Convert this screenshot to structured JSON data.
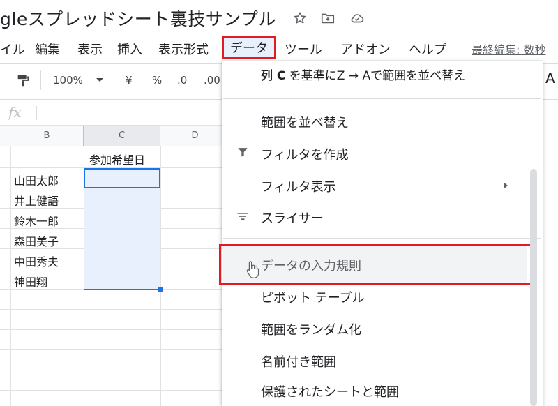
{
  "header": {
    "title": "gleスプレッドシート裏技サンプル",
    "icons": [
      "star-icon",
      "move-to-folder-icon",
      "cloud-saved-icon"
    ]
  },
  "menubar": {
    "items": [
      "イル",
      "編集",
      "表示",
      "挿入",
      "表示形式",
      "データ",
      "ツール",
      "アドオン",
      "ヘルプ"
    ],
    "last_edit": "最終編集: 数秒"
  },
  "toolbar": {
    "zoom": "100%",
    "currency": "¥",
    "percent": "%",
    "decrease_decimal": ".0",
    "increase_decimal": ".00",
    "text_color_glyph": "A"
  },
  "formula_bar": {
    "fx_label": "fx",
    "value": ""
  },
  "grid": {
    "columns": [
      "B",
      "C",
      "D"
    ],
    "header_cell": "参加希望日",
    "names": [
      "山田太郎",
      "井上健語",
      "鈴木一郎",
      "森田美子",
      "中田秀夫",
      "神田翔"
    ]
  },
  "data_menu": {
    "items": [
      {
        "label": "列 C を基準にZ → Aで範囲を並べ替え",
        "bold_prefix": "列 C",
        "icon": ""
      },
      {
        "label": "範囲を並べ替え",
        "icon": ""
      },
      {
        "label": "フィルタを作成",
        "icon": "filter-icon"
      },
      {
        "label": "フィルタ表示",
        "icon": "",
        "submenu": true
      },
      {
        "label": "スライサー",
        "icon": "slicer-icon"
      },
      {
        "label": "データの入力規則",
        "icon": "",
        "highlighted": true
      },
      {
        "label": "ピボット テーブル",
        "icon": ""
      },
      {
        "label": "範囲をランダム化",
        "icon": ""
      },
      {
        "label": "名前付き範囲",
        "icon": ""
      },
      {
        "label": "保護されたシートと範囲",
        "icon": ""
      }
    ]
  },
  "colors": {
    "highlight_border": "#e01b24",
    "selection_blue": "#1a73e8",
    "selection_fill": "#e8f0fe"
  }
}
